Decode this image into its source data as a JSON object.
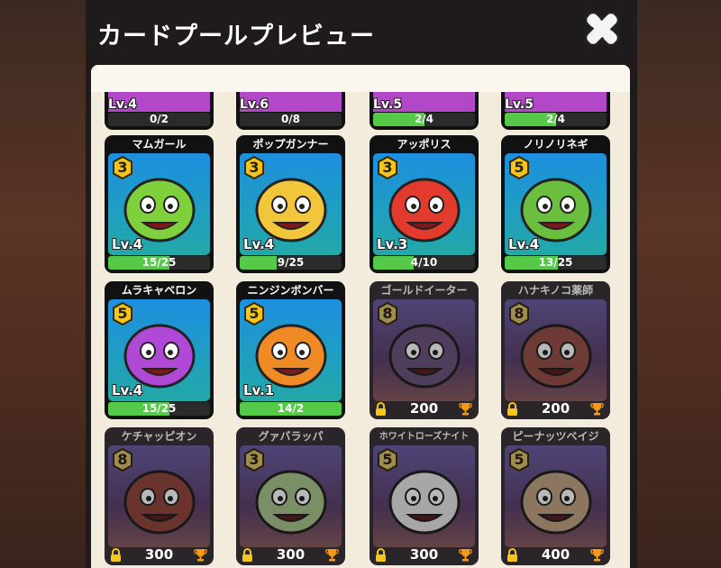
{
  "title": "カードプールプレビュー",
  "colors": {
    "owned_bg": "#1d8fe0",
    "locked_bg": "#6f4a9a",
    "progress": "#55c948",
    "panel": "#f3ecdd"
  },
  "top_row": [
    {
      "level": "Lv.4",
      "progress": "0/2",
      "fill": 0.0
    },
    {
      "level": "Lv.6",
      "progress": "0/8",
      "fill": 0.0
    },
    {
      "level": "Lv.5",
      "progress": "2/4",
      "fill": 0.5
    },
    {
      "level": "Lv.5",
      "progress": "2/4",
      "fill": 0.5
    }
  ],
  "cards": [
    {
      "name": "マムガール",
      "cost": "3",
      "level": "Lv.4",
      "progress": "15/25",
      "fill": 0.6,
      "locked": false,
      "color": "#7fd13b"
    },
    {
      "name": "ポップガンナー",
      "cost": "3",
      "level": "Lv.4",
      "progress": "9/25",
      "fill": 0.36,
      "locked": false,
      "color": "#f2c63a"
    },
    {
      "name": "アッポリス",
      "cost": "3",
      "level": "Lv.3",
      "progress": "4/10",
      "fill": 0.4,
      "locked": false,
      "color": "#e23b2d"
    },
    {
      "name": "ノリノリネギ",
      "cost": "5",
      "level": "Lv.4",
      "progress": "13/25",
      "fill": 0.52,
      "locked": false,
      "color": "#6bbf3f"
    },
    {
      "name": "ムラキャベロン",
      "cost": "5",
      "level": "Lv.4",
      "progress": "15/25",
      "fill": 0.6,
      "locked": false,
      "color": "#b04ad6"
    },
    {
      "name": "ニンジンボンバー",
      "cost": "5",
      "level": "Lv.1",
      "progress": "14/2",
      "fill": 1.0,
      "locked": false,
      "color": "#f08a24"
    },
    {
      "name": "ゴールドイーター",
      "cost": "8",
      "price": "200",
      "locked": true,
      "color": "#7a4e9a"
    },
    {
      "name": "ハナキノコ薬師",
      "cost": "8",
      "price": "200",
      "locked": true,
      "color": "#c8443a"
    },
    {
      "name": "ケチャッピオン",
      "cost": "8",
      "price": "300",
      "locked": true,
      "color": "#c83a2a"
    },
    {
      "name": "グァバラッパ",
      "cost": "3",
      "price": "300",
      "locked": true,
      "color": "#9ccf6a"
    },
    {
      "name": "ホワイトローズナイト",
      "cost": "5",
      "price": "300",
      "locked": true,
      "color": "#e8e8e8"
    },
    {
      "name": "ピーナッツベイジ",
      "cost": "5",
      "price": "400",
      "locked": true,
      "color": "#d8a06a"
    }
  ]
}
